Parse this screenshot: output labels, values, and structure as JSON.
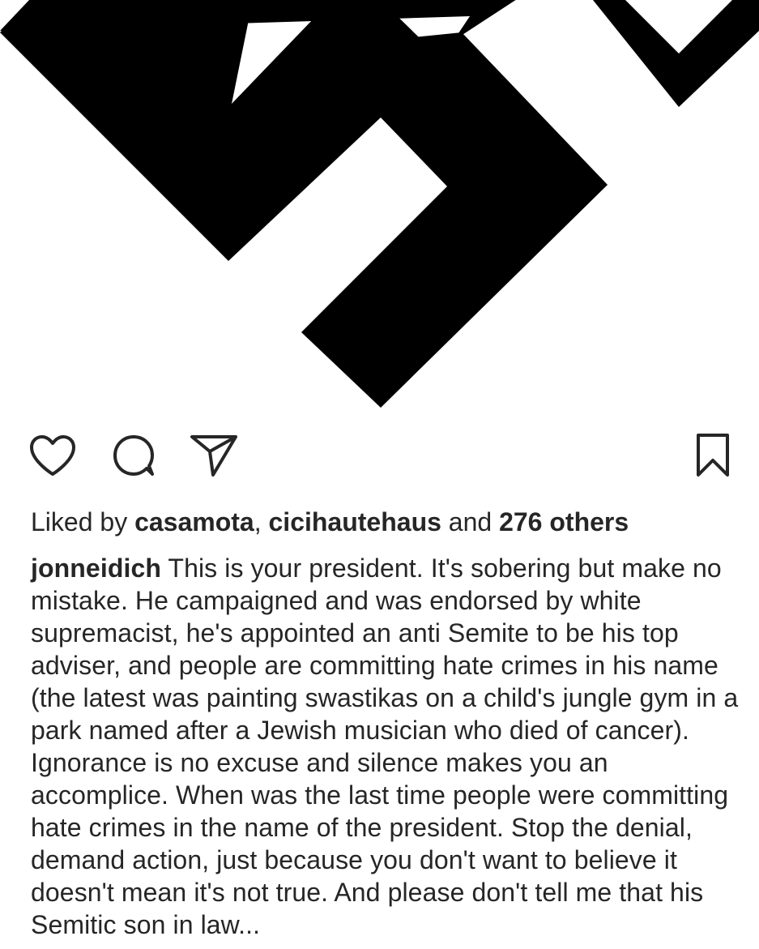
{
  "post": {
    "image_icon": "post-graphic-image"
  },
  "actions": {
    "like_icon": "heart-icon",
    "comment_icon": "comment-icon",
    "share_icon": "paper-plane-icon",
    "save_icon": "bookmark-icon"
  },
  "likes": {
    "prefix": "Liked by ",
    "user1": "casamota",
    "separator": ", ",
    "user2": "cicihautehaus",
    "conjunction": " and ",
    "others": "276 others"
  },
  "caption": {
    "username": "jonneidich",
    "text": "This is your president. It's sobering but make no mistake. He campaigned and was endorsed by white supremacist, he's appointed an anti Semite to be his top adviser, and people are committing hate crimes in his name (the latest was painting swastikas on a child's jungle gym in a park named after a Jewish musician who died of cancer). Ignorance is no excuse and silence makes you an accomplice. When was the last time people were committing hate crimes in the name of the president. Stop the denial, demand action, just because you don't want to believe it doesn't mean it's not true. And please don't tell me that his Semitic son in law..."
  },
  "colors": {
    "text": "#262626",
    "image_ink": "#000000",
    "background": "#ffffff"
  }
}
